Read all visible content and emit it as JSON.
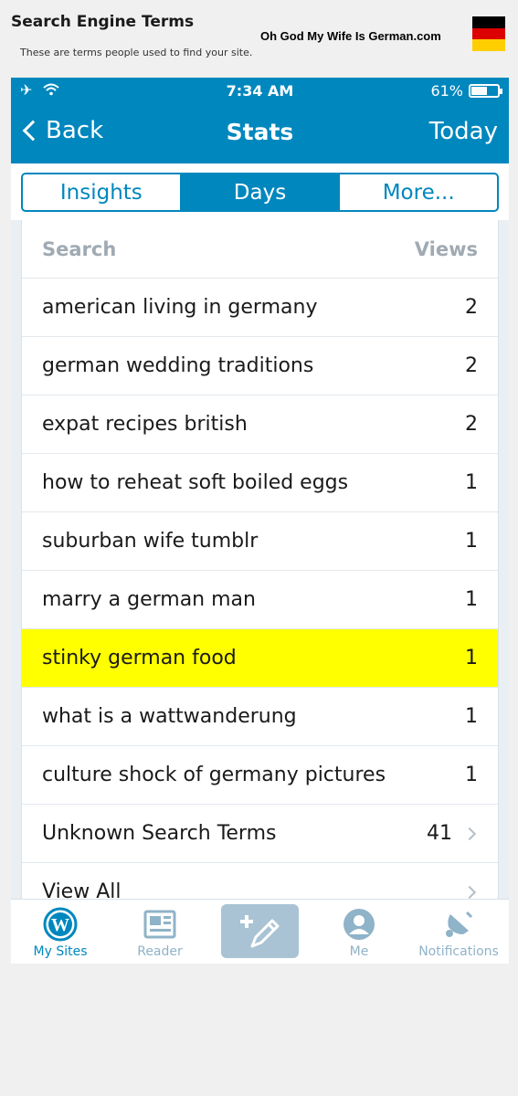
{
  "page": {
    "title": "Search Engine Terms",
    "subtitle": "These are terms people used to find your site.",
    "blog_name": "Oh God My Wife Is German.com",
    "flag_colors": [
      "#000000",
      "#dd0000",
      "#ffce00"
    ]
  },
  "status_bar": {
    "time": "7:34 AM",
    "battery": "61%",
    "battery_level": 0.61,
    "icons": [
      "airplane-icon",
      "wifi-icon"
    ]
  },
  "nav": {
    "back_label": "Back",
    "title": "Stats",
    "right_label": "Today"
  },
  "segments": [
    {
      "label": "Insights",
      "active": false
    },
    {
      "label": "Days",
      "active": true
    },
    {
      "label": "More...",
      "active": false
    }
  ],
  "table": {
    "header": {
      "search": "Search",
      "views": "Views"
    },
    "rows": [
      {
        "term": "american living in germany",
        "views": "2",
        "highlight": false
      },
      {
        "term": "german wedding traditions",
        "views": "2",
        "highlight": false
      },
      {
        "term": "expat recipes british",
        "views": "2",
        "highlight": false
      },
      {
        "term": "how to reheat soft boiled eggs",
        "views": "1",
        "highlight": false
      },
      {
        "term": "suburban wife tumblr",
        "views": "1",
        "highlight": false
      },
      {
        "term": "marry a german man",
        "views": "1",
        "highlight": false
      },
      {
        "term": "stinky german food",
        "views": "1",
        "highlight": true
      },
      {
        "term": "what is a wattwanderung",
        "views": "1",
        "highlight": false
      },
      {
        "term": "culture shock of germany pictures",
        "views": "1",
        "highlight": false
      }
    ],
    "unknown": {
      "term": "Unknown Search Terms",
      "views": "41"
    },
    "view_all": "View All"
  },
  "tab_bar": {
    "items": [
      {
        "label": "My Sites",
        "icon": "wordpress-icon",
        "active": true
      },
      {
        "label": "Reader",
        "icon": "reader-icon",
        "active": false
      },
      {
        "label": "",
        "icon": "write-post-icon",
        "active": false
      },
      {
        "label": "Me",
        "icon": "profile-icon",
        "active": false
      },
      {
        "label": "Notifications",
        "icon": "bell-icon",
        "active": false
      }
    ]
  },
  "colors": {
    "accent": "#0087be",
    "highlight": "#ffff00",
    "tab_inactive": "#8fb3c8"
  }
}
